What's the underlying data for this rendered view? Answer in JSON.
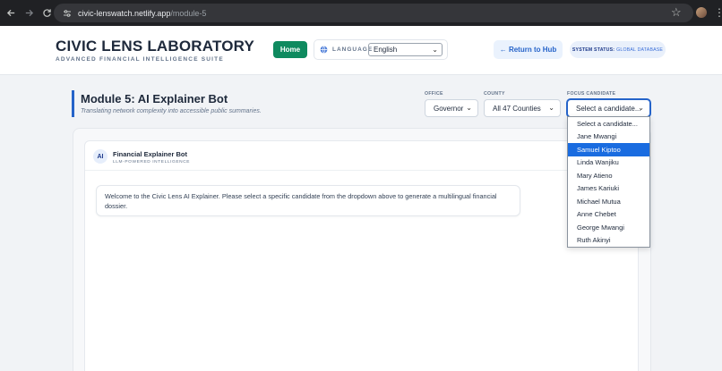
{
  "browser": {
    "url_host": "civic-lenswatch.netlify.app",
    "url_path": "/module-5",
    "icons": [
      "back-arrow-icon",
      "forward-arrow-icon",
      "reload-icon",
      "site-settings-icon",
      "star-icon",
      "profile-avatar",
      "kebab-menu-icon"
    ]
  },
  "header": {
    "title": "CIVIC LENS LABORATORY",
    "subtitle": "ADVANCED FINANCIAL INTELLIGENCE SUITE",
    "home_label": "Home",
    "language_label": "LANGUAGE",
    "language_value": "English",
    "return_label": "← Return to Hub",
    "status_key": "SYSTEM STATUS:",
    "status_value": "GLOBAL DATABASE"
  },
  "module": {
    "title": "Module 5: AI Explainer Bot",
    "subtitle": "Translating network complexity into accessible public summaries."
  },
  "filters": {
    "office_label": "OFFICE",
    "office_value": "Governor",
    "county_label": "COUNTY",
    "county_value": "All 47 Counties",
    "candidate_label": "FOCUS CANDIDATE",
    "candidate_value": "Select a candidate..."
  },
  "candidate_options": [
    "Select a candidate...",
    "Jane Mwangi",
    "Samuel Kiptoo",
    "Linda Wanjiku",
    "Mary Atieno",
    "James Kariuki",
    "Michael Mutua",
    "Anne Chebet",
    "George Mwangi",
    "Ruth Akinyi"
  ],
  "candidate_highlighted": "Samuel Kiptoo",
  "chat": {
    "avatar_text": "AI",
    "bot_name": "Financial Explainer Bot",
    "bot_tag": "LLM-POWERED INTELLIGENCE",
    "message": "Welcome to the Civic Lens AI Explainer. Please select a specific candidate from the dropdown above to generate a multilingual financial dossier."
  },
  "colors": {
    "primary_green": "#0f8a5f",
    "accent_blue": "#2563c9",
    "selection_blue": "#1a6ce0"
  }
}
